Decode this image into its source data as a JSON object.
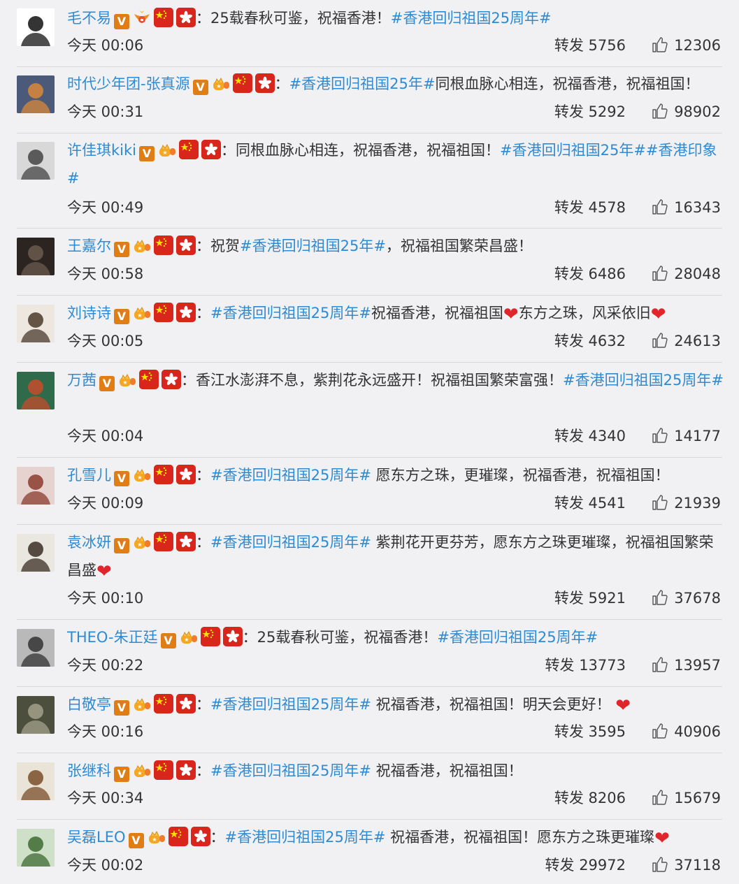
{
  "labels": {
    "repost": "转发"
  },
  "colors": {
    "link": "#2e8bd3",
    "badge": "#e07d14",
    "flag_red": "#d9261c",
    "heart": "#e0252b"
  },
  "items": [
    {
      "user": "毛不易",
      "crown_style": "gold-wings",
      "segments": [
        {
          "t": "text",
          "v": "：25载春秋可鉴，祝福香港！"
        },
        {
          "t": "topic",
          "v": "#香港回归祖国25周年#"
        }
      ],
      "time": "今天 00:06",
      "reposts": "5756",
      "likes": "12306"
    },
    {
      "user": "时代少年团-张真源",
      "crown_style": "crown",
      "segments": [
        {
          "t": "text",
          "v": "："
        },
        {
          "t": "topic",
          "v": "#香港回归祖国25年#"
        },
        {
          "t": "text",
          "v": "同根血脉心相连，祝福香港，祝福祖国！"
        }
      ],
      "time": "今天 00:31",
      "reposts": "5292",
      "likes": "98902"
    },
    {
      "user": "许佳琪kiki",
      "crown_style": "crown",
      "segments": [
        {
          "t": "text",
          "v": "：同根血脉心相连，祝福香港，祝福祖国！"
        },
        {
          "t": "topic",
          "v": "#香港回归祖国25年##香港印象#"
        }
      ],
      "time": "今天 00:49",
      "reposts": "4578",
      "likes": "16343"
    },
    {
      "user": "王嘉尔",
      "crown_style": "crown",
      "segments": [
        {
          "t": "text",
          "v": "：祝贺"
        },
        {
          "t": "topic",
          "v": "#香港回归祖国25年#"
        },
        {
          "t": "text",
          "v": "，祝福祖国繁荣昌盛！"
        }
      ],
      "time": "今天 00:58",
      "reposts": "6486",
      "likes": "28048"
    },
    {
      "user": "刘诗诗",
      "crown_style": "crown",
      "segments": [
        {
          "t": "text",
          "v": "："
        },
        {
          "t": "topic",
          "v": "#香港回归祖国25周年#"
        },
        {
          "t": "text",
          "v": "祝福香港，祝福祖国"
        },
        {
          "t": "heart",
          "v": "❤"
        },
        {
          "t": "text",
          "v": "东方之珠，风采依旧"
        },
        {
          "t": "heart",
          "v": "❤"
        }
      ],
      "time": "今天 00:05",
      "reposts": "4632",
      "likes": "24613"
    },
    {
      "user": "万茜",
      "crown_style": "crown",
      "segments": [
        {
          "t": "text",
          "v": "：香江水澎湃不息，紫荆花永远盛开！祝福祖国繁荣富强！"
        },
        {
          "t": "topic",
          "v": "#香港回归祖国25周年#"
        }
      ],
      "time": "今天 00:04",
      "reposts": "4340",
      "likes": "14177"
    },
    {
      "user": "孔雪儿",
      "crown_style": "crown",
      "segments": [
        {
          "t": "text",
          "v": "："
        },
        {
          "t": "topic",
          "v": "#香港回归祖国25周年#"
        },
        {
          "t": "text",
          "v": " 愿东方之珠，更璀璨，祝福香港，祝福祖国！"
        }
      ],
      "time": "今天 00:09",
      "reposts": "4541",
      "likes": "21939"
    },
    {
      "user": "袁冰妍",
      "crown_style": "crown",
      "segments": [
        {
          "t": "text",
          "v": "："
        },
        {
          "t": "topic",
          "v": "#香港回归祖国25周年#"
        },
        {
          "t": "text",
          "v": " 紫荆花开更芬芳，愿东方之珠更璀璨，祝福祖国繁荣昌盛"
        },
        {
          "t": "heart",
          "v": "❤"
        }
      ],
      "time": "今天 00:10",
      "reposts": "5921",
      "likes": "37678"
    },
    {
      "user": "THEO-朱正廷",
      "crown_style": "crown",
      "segments": [
        {
          "t": "text",
          "v": "：25载春秋可鉴，祝福香港！"
        },
        {
          "t": "topic",
          "v": "#香港回归祖国25周年#"
        }
      ],
      "time": "今天 00:22",
      "reposts": "13773",
      "likes": "13957"
    },
    {
      "user": "白敬亭",
      "crown_style": "crown",
      "segments": [
        {
          "t": "text",
          "v": "："
        },
        {
          "t": "topic",
          "v": "#香港回归祖国25周年#"
        },
        {
          "t": "text",
          "v": " 祝福香港，祝福祖国！明天会更好！ "
        },
        {
          "t": "heart",
          "v": "❤"
        }
      ],
      "time": "今天 00:16",
      "reposts": "3595",
      "likes": "40906"
    },
    {
      "user": "张继科",
      "crown_style": "crown",
      "segments": [
        {
          "t": "text",
          "v": "："
        },
        {
          "t": "topic",
          "v": "#香港回归祖国25周年#"
        },
        {
          "t": "text",
          "v": " 祝福香港，祝福祖国！"
        }
      ],
      "time": "今天 00:34",
      "reposts": "8206",
      "likes": "15679"
    },
    {
      "user": "吴磊LEO",
      "crown_style": "crown",
      "segments": [
        {
          "t": "text",
          "v": "："
        },
        {
          "t": "topic",
          "v": "#香港回归祖国25周年#"
        },
        {
          "t": "text",
          "v": " 祝福香港，祝福祖国！愿东方之珠更璀璨"
        },
        {
          "t": "heart",
          "v": "❤"
        }
      ],
      "time": "今天 00:02",
      "reposts": "29972",
      "likes": "37118"
    }
  ]
}
